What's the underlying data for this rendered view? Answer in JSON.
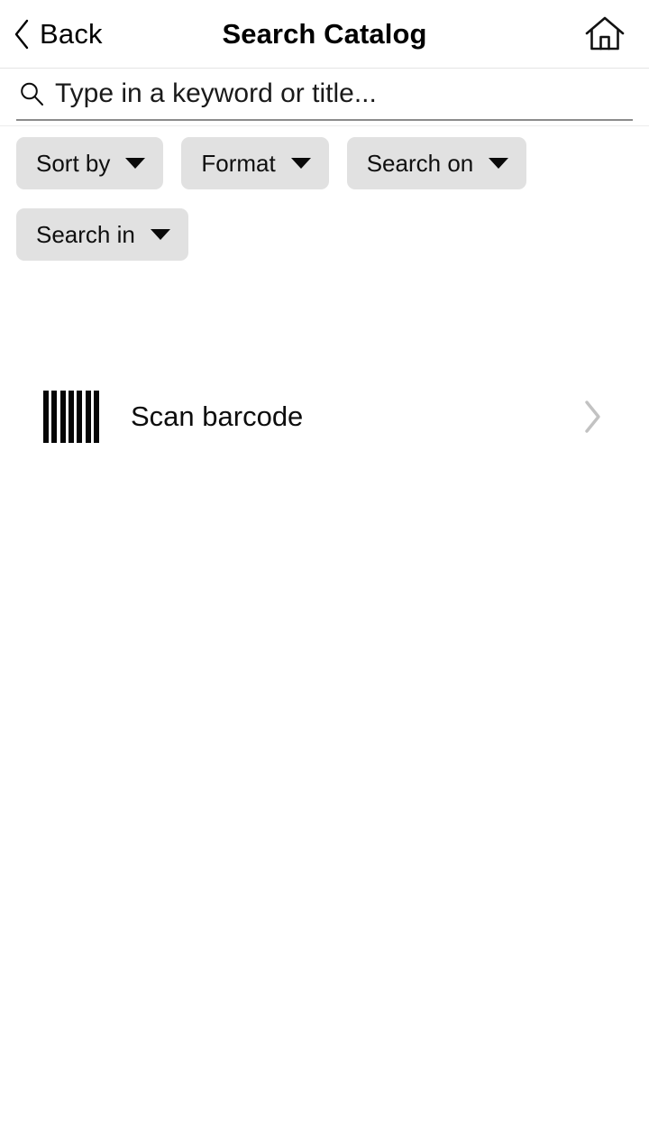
{
  "header": {
    "back_label": "Back",
    "title": "Search Catalog",
    "back_icon": "chevron-left-icon",
    "home_icon": "home-icon"
  },
  "search": {
    "placeholder": "Type in a keyword or title...",
    "value": "",
    "icon": "search-icon"
  },
  "filters": {
    "chips": [
      {
        "label": "Sort by",
        "icon": "chevron-down-icon"
      },
      {
        "label": "Format",
        "icon": "chevron-down-icon"
      },
      {
        "label": "Search on",
        "icon": "chevron-down-icon"
      },
      {
        "label": "Search in",
        "icon": "chevron-down-icon"
      }
    ]
  },
  "actions": {
    "scan": {
      "label": "Scan barcode",
      "icon": "barcode-icon",
      "chevron": "chevron-right-icon"
    }
  },
  "colors": {
    "background": "#ffffff",
    "text": "#000000",
    "chip_background": "#e1e1e1",
    "underline": "#8c8c8c",
    "divider": "#e4e4e4",
    "chevron_muted": "#c2c2c2"
  }
}
